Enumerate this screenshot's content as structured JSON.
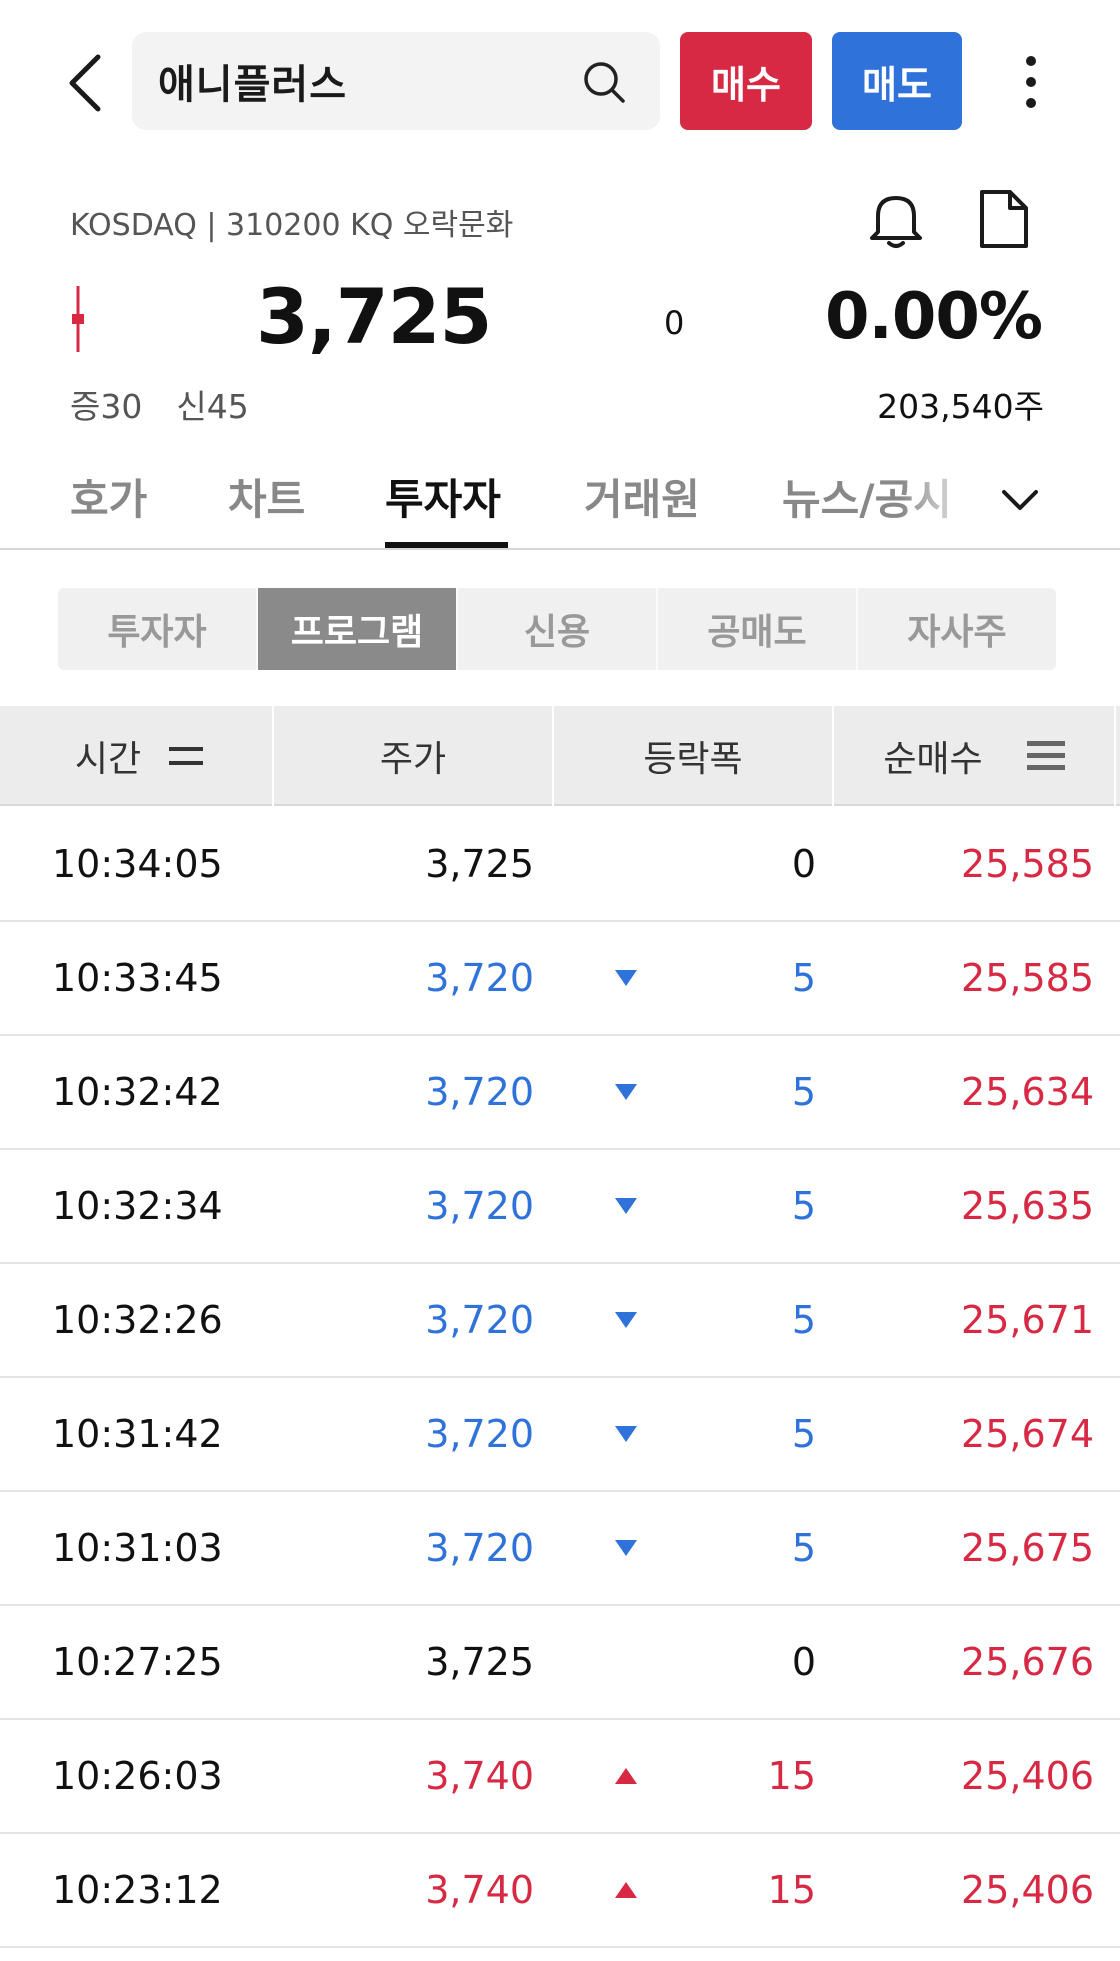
{
  "header": {
    "stock_name": "애니플러스",
    "buy_label": "매수",
    "sell_label": "매도"
  },
  "stock": {
    "market_line": "KOSDAQ | 310200 KQ 오락문화",
    "price": "3,725",
    "change": "0",
    "rate": "0.00%",
    "margin_label": "증30",
    "credit_label": "신45",
    "volume": "203,540주"
  },
  "tabs": [
    {
      "label": "호가"
    },
    {
      "label": "차트"
    },
    {
      "label": "투자자"
    },
    {
      "label": "거래원"
    },
    {
      "label": "뉴스/공시"
    }
  ],
  "active_tab": "투자자",
  "segments": [
    {
      "label": "투자자"
    },
    {
      "label": "프로그램"
    },
    {
      "label": "신용"
    },
    {
      "label": "공매도"
    },
    {
      "label": "자사주"
    }
  ],
  "active_segment": "프로그램",
  "table": {
    "columns": [
      "시간",
      "주가",
      "등락폭",
      "순매수"
    ],
    "rows": [
      {
        "time": "10:34:05",
        "price": "3,725",
        "direction": "flat",
        "diff": "0",
        "net": "25,585"
      },
      {
        "time": "10:33:45",
        "price": "3,720",
        "direction": "down",
        "diff": "5",
        "net": "25,585"
      },
      {
        "time": "10:32:42",
        "price": "3,720",
        "direction": "down",
        "diff": "5",
        "net": "25,634"
      },
      {
        "time": "10:32:34",
        "price": "3,720",
        "direction": "down",
        "diff": "5",
        "net": "25,635"
      },
      {
        "time": "10:32:26",
        "price": "3,720",
        "direction": "down",
        "diff": "5",
        "net": "25,671"
      },
      {
        "time": "10:31:42",
        "price": "3,720",
        "direction": "down",
        "diff": "5",
        "net": "25,674"
      },
      {
        "time": "10:31:03",
        "price": "3,720",
        "direction": "down",
        "diff": "5",
        "net": "25,675"
      },
      {
        "time": "10:27:25",
        "price": "3,725",
        "direction": "flat",
        "diff": "0",
        "net": "25,676"
      },
      {
        "time": "10:26:03",
        "price": "3,740",
        "direction": "up",
        "diff": "15",
        "net": "25,406"
      },
      {
        "time": "10:23:12",
        "price": "3,740",
        "direction": "up",
        "diff": "15",
        "net": "25,406"
      }
    ]
  },
  "colors": {
    "up": "#d72944",
    "down": "#2f72da",
    "buy_button": "#d72944",
    "sell_button": "#2f72da"
  },
  "icons": [
    "back-arrow-icon",
    "search-icon",
    "more-vertical-icon",
    "bell-icon",
    "document-icon",
    "candle-icon",
    "chevron-down-icon",
    "sort-icon"
  ]
}
